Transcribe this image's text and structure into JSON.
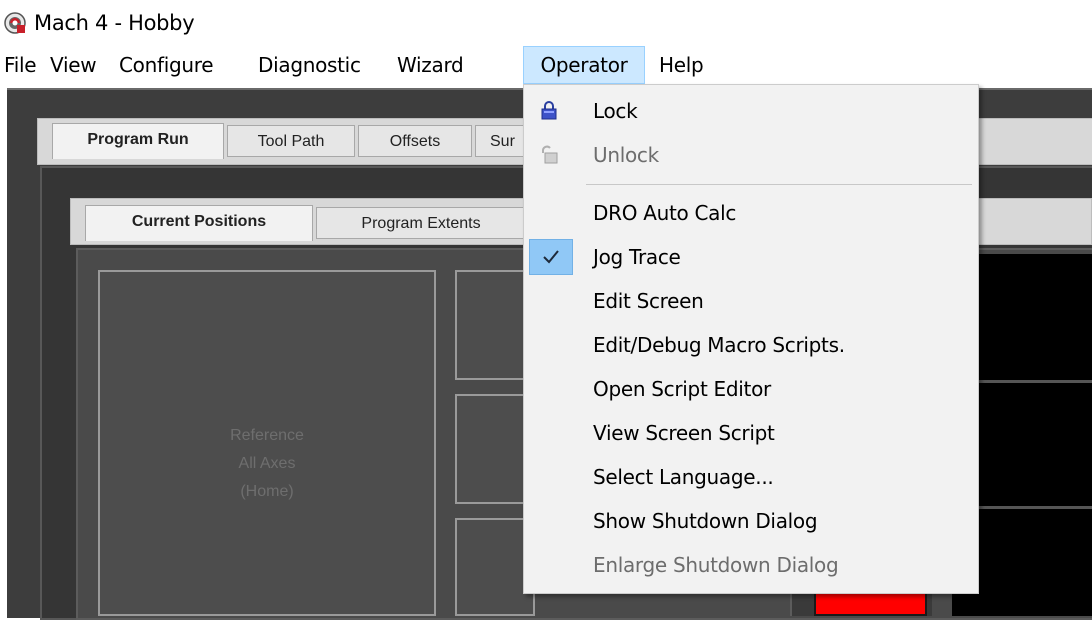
{
  "window": {
    "title": "Mach 4 - Hobby",
    "icon": "mach4-app-icon"
  },
  "menubar": {
    "items": [
      "File",
      "View",
      "Configure",
      "Diagnostic",
      "Wizard",
      "Operator",
      "Help"
    ],
    "active": "Operator"
  },
  "outer_tabs": [
    "Program Run",
    "Tool Path",
    "Offsets",
    "Sur"
  ],
  "inner_tabs": [
    "Current Positions",
    "Program Extents"
  ],
  "reference_button": {
    "line1": "Reference",
    "line2": "All Axes",
    "line3": "(Home)"
  },
  "operator_menu": {
    "items": [
      {
        "label": "Lock",
        "icon": "lock-icon",
        "enabled": true
      },
      {
        "label": "Unlock",
        "icon": "unlock-icon",
        "enabled": false
      },
      {
        "label": "DRO Auto Calc",
        "enabled": true
      },
      {
        "label": "Jog Trace",
        "checked": true,
        "enabled": true
      },
      {
        "label": "Edit Screen",
        "enabled": true
      },
      {
        "label": "Edit/Debug Macro Scripts.",
        "enabled": true
      },
      {
        "label": "Open Script Editor",
        "enabled": true
      },
      {
        "label": "View Screen Script",
        "enabled": true
      },
      {
        "label": "Select Language...",
        "enabled": true
      },
      {
        "label": "Show Shutdown Dialog",
        "enabled": true
      },
      {
        "label": "Enlarge Shutdown Dialog",
        "enabled": false
      }
    ]
  },
  "colors": {
    "menu_highlight": "#cce8ff",
    "check_highlight": "#90c8f6",
    "disabled_text": "#6d6d6d",
    "estop_red": "#ff0000"
  }
}
